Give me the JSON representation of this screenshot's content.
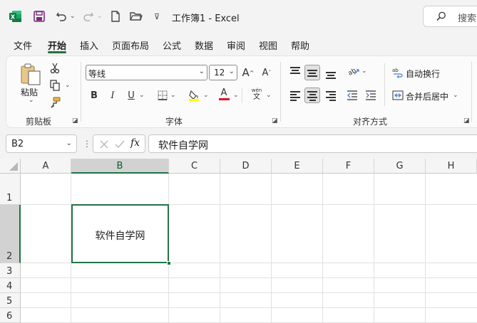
{
  "window": {
    "title": "工作簿1  -  Excel",
    "search_placeholder": "搜索"
  },
  "tabs": [
    "文件",
    "开始",
    "插入",
    "页面布局",
    "公式",
    "数据",
    "审阅",
    "视图",
    "帮助"
  ],
  "active_tab": "开始",
  "ribbon": {
    "clipboard": {
      "paste_label": "粘贴",
      "group_label": "剪贴板"
    },
    "font": {
      "font_name": "等线",
      "font_size": "12",
      "bold": "B",
      "italic": "I",
      "underline": "U",
      "font_color_letter": "A",
      "grow_font": "A",
      "shrink_font": "A",
      "phonetic": "wén",
      "phonetic_sub": "文",
      "group_label": "字体",
      "font_color": "#e81123",
      "highlight_color": "#ffff00"
    },
    "alignment": {
      "wrap_text": "自动换行",
      "merge_center": "合并后居中",
      "group_label": "对齐方式"
    }
  },
  "formula_bar": {
    "name_box": "B2",
    "fx": "fx",
    "content": "软件自学网"
  },
  "sheet": {
    "columns": [
      "A",
      "B",
      "C",
      "D",
      "E",
      "F",
      "G",
      "H"
    ],
    "rows": [
      "1",
      "2",
      "3",
      "4",
      "5",
      "6"
    ],
    "selected_cell": "B2",
    "cell_b2": "软件自学网"
  },
  "colors": {
    "accent": "#217346"
  }
}
